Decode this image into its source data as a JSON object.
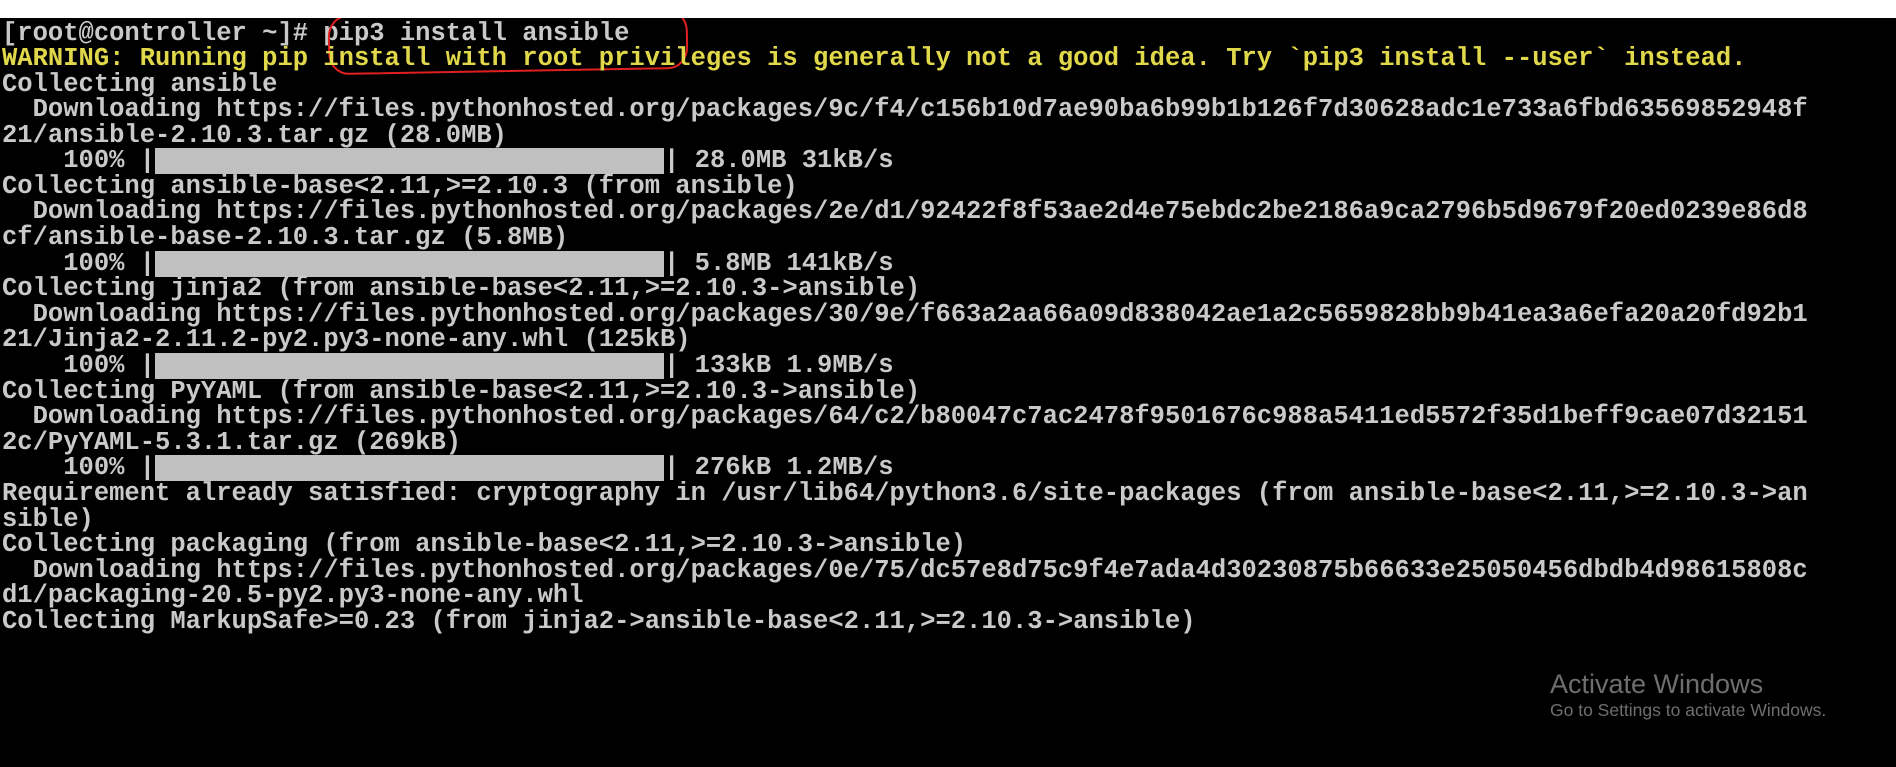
{
  "terminal": {
    "prompt": "[root@controller ~]# ",
    "command": "pip3 install ansible",
    "warning": "WARNING: Running pip install with root privileges is generally not a good idea. Try `pip3 install --user` instead.",
    "lines": [
      "Collecting ansible",
      "  Downloading https://files.pythonhosted.org/packages/9c/f4/c156b10d7ae90ba6b99b1b126f7d30628adc1e733a6fbd63569852948f",
      "21/ansible-2.10.3.tar.gz (28.0MB)",
      "Collecting ansible-base<2.11,>=2.10.3 (from ansible)",
      "  Downloading https://files.pythonhosted.org/packages/2e/d1/92422f8f53ae2d4e75ebdc2be2186a9ca2796b5d9679f20ed0239e86d8",
      "cf/ansible-base-2.10.3.tar.gz (5.8MB)",
      "Collecting jinja2 (from ansible-base<2.11,>=2.10.3->ansible)",
      "  Downloading https://files.pythonhosted.org/packages/30/9e/f663a2aa66a09d838042ae1a2c5659828bb9b41ea3a6efa20a20fd92b1",
      "21/Jinja2-2.11.2-py2.py3-none-any.whl (125kB)",
      "Collecting PyYAML (from ansible-base<2.11,>=2.10.3->ansible)",
      "  Downloading https://files.pythonhosted.org/packages/64/c2/b80047c7ac2478f9501676c988a5411ed5572f35d1beff9cae07d32151",
      "2c/PyYAML-5.3.1.tar.gz (269kB)",
      "Requirement already satisfied: cryptography in /usr/lib64/python3.6/site-packages (from ansible-base<2.11,>=2.10.3->an",
      "sible)",
      "Collecting packaging (from ansible-base<2.11,>=2.10.3->ansible)",
      "  Downloading https://files.pythonhosted.org/packages/0e/75/dc57e8d75c9f4e7ada4d30230875b66633e25050456dbdb4d98615808c",
      "d1/packaging-20.5-py2.py3-none-any.whl",
      "Collecting MarkupSafe>=0.23 (from jinja2->ansible-base<2.11,>=2.10.3->ansible)"
    ],
    "progress": [
      {
        "percent_label": "    100% |",
        "end": "| 28.0MB 31kB/s",
        "value": 100
      },
      {
        "percent_label": "    100% |",
        "end": "| 5.8MB 141kB/s",
        "value": 100
      },
      {
        "percent_label": "    100% |",
        "end": "| 133kB 1.9MB/s",
        "value": 100
      },
      {
        "percent_label": "    100% |",
        "end": "| 276kB 1.2MB/s",
        "value": 100
      }
    ]
  },
  "watermark": {
    "title": "Activate Windows",
    "subtitle": "Go to Settings to activate Windows."
  },
  "colors": {
    "background": "#000000",
    "text": "#c9c9c9",
    "warning": "#e0d84a",
    "highlight": "#e02020",
    "progress_fill": "#c0c0c0"
  }
}
